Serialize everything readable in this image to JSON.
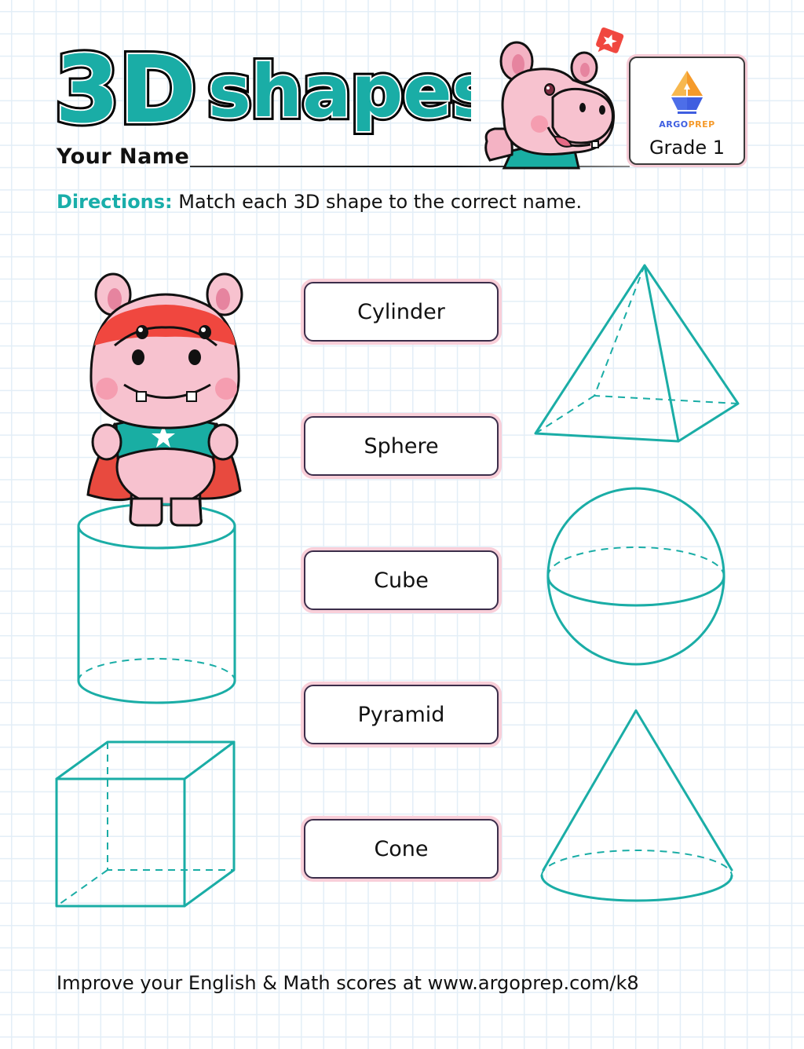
{
  "header": {
    "title_part1": "3D",
    "title_part2": "shapes",
    "name_label": "Your Name",
    "name_value": ""
  },
  "badge": {
    "brand_part1": "ARGO",
    "brand_part2": "PREP",
    "grade": "Grade 1"
  },
  "directions": {
    "lead": "Directions:",
    "text": " Match each 3D shape to the correct name."
  },
  "name_cards": [
    {
      "label": "Cylinder"
    },
    {
      "label": "Sphere"
    },
    {
      "label": "Cube"
    },
    {
      "label": "Pyramid"
    },
    {
      "label": "Cone"
    }
  ],
  "shapes": {
    "left": [
      "cylinder",
      "cube"
    ],
    "right": [
      "pyramid",
      "sphere",
      "cone"
    ]
  },
  "colors": {
    "accent_teal": "#1aada6",
    "card_glow_pink": "#f9cfd9",
    "brand_blue": "#3f5ee0",
    "brand_orange": "#f59a2a",
    "hero_red": "#f0473f"
  },
  "footer": {
    "text": "Improve your English & Math scores at www.argoprep.com/k8"
  }
}
